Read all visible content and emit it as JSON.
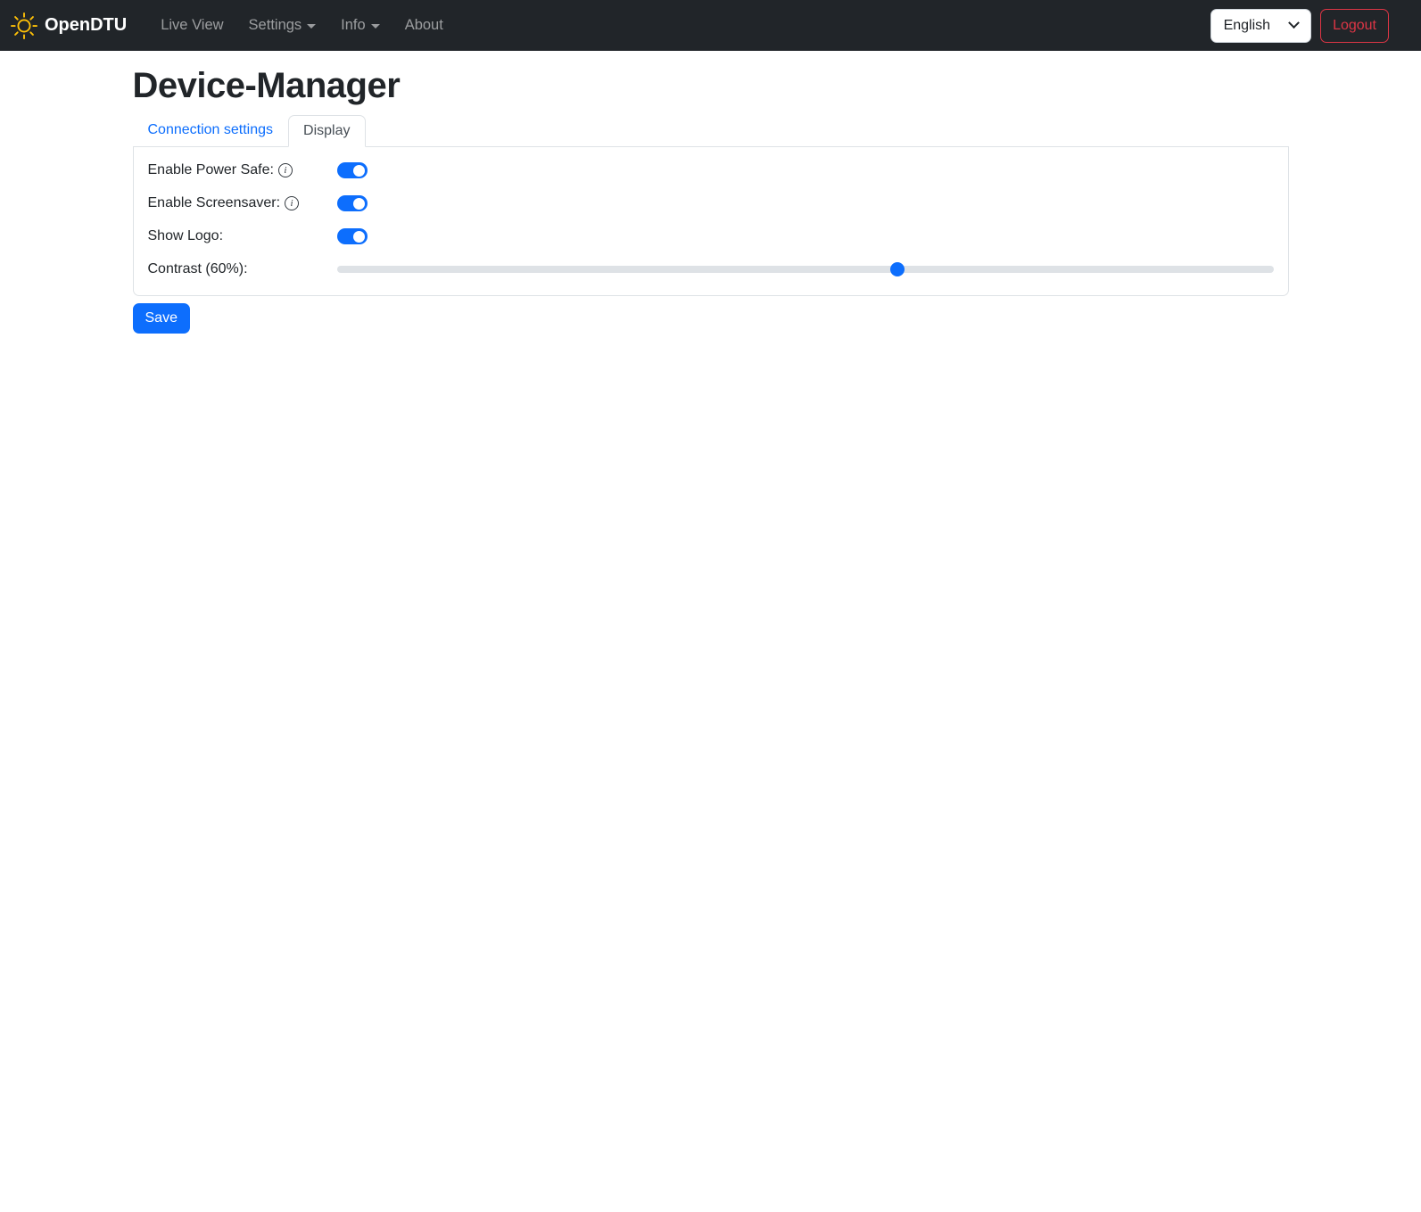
{
  "navbar": {
    "brand": "OpenDTU",
    "items": [
      {
        "label": "Live View",
        "dropdown": false
      },
      {
        "label": "Settings",
        "dropdown": true
      },
      {
        "label": "Info",
        "dropdown": true
      },
      {
        "label": "About",
        "dropdown": false
      }
    ],
    "language_selected": "English",
    "logout_label": "Logout"
  },
  "page": {
    "title": "Device-Manager"
  },
  "tabs": [
    {
      "label": "Connection settings",
      "active": false
    },
    {
      "label": "Display",
      "active": true
    }
  ],
  "form": {
    "fields": [
      {
        "label": "Enable Power Safe:",
        "has_info": true,
        "type": "switch",
        "value": true
      },
      {
        "label": "Enable Screensaver:",
        "has_info": true,
        "type": "switch",
        "value": true
      },
      {
        "label": "Show Logo:",
        "has_info": false,
        "type": "switch",
        "value": true
      },
      {
        "label": "Contrast (60%):",
        "has_info": false,
        "type": "range",
        "value": 60,
        "min": 0,
        "max": 100
      }
    ],
    "save_label": "Save"
  },
  "icons": {
    "brand": "sun-icon",
    "info": "info-circle-icon",
    "select_arrow": "chevron-down-icon",
    "dropdown_caret": "caret-down-icon"
  },
  "colors": {
    "accent": "#0d6efd",
    "danger": "#dc3545",
    "navbar_bg": "#212529",
    "brand_icon": "#ffc107",
    "border": "#dee2e6"
  }
}
